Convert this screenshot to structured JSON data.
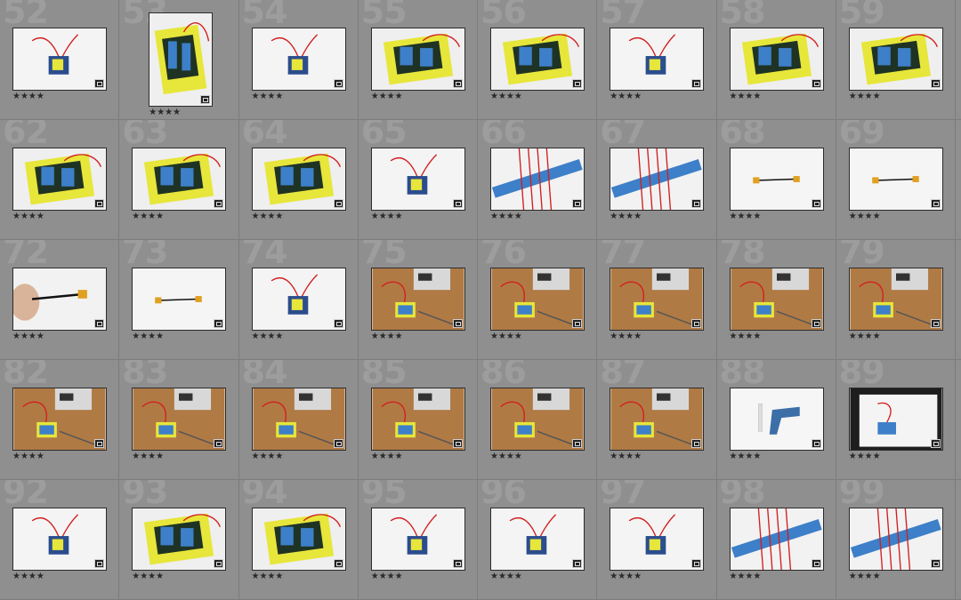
{
  "grid": {
    "cells": [
      {
        "number": "52",
        "rating": "★★★★",
        "scene": "white"
      },
      {
        "number": "53",
        "rating": "★★★★",
        "scene": "yellow",
        "portrait": true
      },
      {
        "number": "54",
        "rating": "★★★★",
        "scene": "white"
      },
      {
        "number": "55",
        "rating": "★★★★",
        "scene": "yellow"
      },
      {
        "number": "56",
        "rating": "★★★★",
        "scene": "yellow"
      },
      {
        "number": "57",
        "rating": "★★★★",
        "scene": "white"
      },
      {
        "number": "58",
        "rating": "★★★★",
        "scene": "yellow"
      },
      {
        "number": "59",
        "rating": "★★★★",
        "scene": "yellow"
      },
      {
        "number": "62",
        "rating": "★★★★",
        "scene": "yellow"
      },
      {
        "number": "63",
        "rating": "★★★★",
        "scene": "yellow"
      },
      {
        "number": "64",
        "rating": "★★★★",
        "scene": "yellow"
      },
      {
        "number": "65",
        "rating": "★★★★",
        "scene": "white"
      },
      {
        "number": "66",
        "rating": "★★★★",
        "scene": "tape"
      },
      {
        "number": "67",
        "rating": "★★★★",
        "scene": "tape"
      },
      {
        "number": "68",
        "rating": "★★★★",
        "scene": "cable"
      },
      {
        "number": "69",
        "rating": "★★★★",
        "scene": "cable"
      },
      {
        "number": "72",
        "rating": "★★★★",
        "scene": "hand"
      },
      {
        "number": "73",
        "rating": "★★★★",
        "scene": "cable"
      },
      {
        "number": "74",
        "rating": "★★★★",
        "scene": "white"
      },
      {
        "number": "75",
        "rating": "★★★★",
        "scene": "bench"
      },
      {
        "number": "76",
        "rating": "★★★★",
        "scene": "bench"
      },
      {
        "number": "77",
        "rating": "★★★★",
        "scene": "bench"
      },
      {
        "number": "78",
        "rating": "★★★★",
        "scene": "bench"
      },
      {
        "number": "79",
        "rating": "★★★★",
        "scene": "bench"
      },
      {
        "number": "82",
        "rating": "★★★★",
        "scene": "bench"
      },
      {
        "number": "83",
        "rating": "★★★★",
        "scene": "bench"
      },
      {
        "number": "84",
        "rating": "★★★★",
        "scene": "bench"
      },
      {
        "number": "85",
        "rating": "★★★★",
        "scene": "bench"
      },
      {
        "number": "86",
        "rating": "★★★★",
        "scene": "bench"
      },
      {
        "number": "87",
        "rating": "★★★★",
        "scene": "bench"
      },
      {
        "number": "88",
        "rating": "★★★★",
        "scene": "glue"
      },
      {
        "number": "89",
        "rating": "★★★★",
        "scene": "dark"
      },
      {
        "number": "92",
        "rating": "★★★★",
        "scene": "white"
      },
      {
        "number": "93",
        "rating": "★★★★",
        "scene": "yellow"
      },
      {
        "number": "94",
        "rating": "★★★★",
        "scene": "yellow"
      },
      {
        "number": "95",
        "rating": "★★★★",
        "scene": "white"
      },
      {
        "number": "96",
        "rating": "★★★★",
        "scene": "white"
      },
      {
        "number": "97",
        "rating": "★★★★",
        "scene": "white"
      },
      {
        "number": "98",
        "rating": "★★★★",
        "scene": "tape"
      },
      {
        "number": "99",
        "rating": "★★★★",
        "scene": "tape"
      }
    ]
  },
  "colors": {
    "grid_background": "#8f8f8f",
    "cell_number": "#9d9d9d",
    "stars": "#2a2a2a",
    "enclosure_yellow": "#e7e63a",
    "tape_blue": "#3d7fc8",
    "wire_red": "#d21f1f",
    "bench_wood": "#b07a45"
  }
}
